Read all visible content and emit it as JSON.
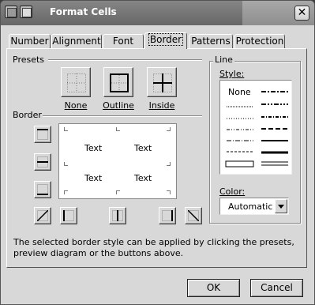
{
  "window": {
    "title": "Format Cells",
    "close_glyph": "✕"
  },
  "tabs": [
    {
      "label": "Number"
    },
    {
      "label": "Alignment"
    },
    {
      "label": "Font"
    },
    {
      "label": "Border",
      "active": true
    },
    {
      "label": "Patterns"
    },
    {
      "label": "Protection"
    }
  ],
  "presets": {
    "group_label": "Presets",
    "items": [
      {
        "label": "None",
        "icon": "border-none-icon"
      },
      {
        "label": "Outline",
        "icon": "border-outline-icon"
      },
      {
        "label": "Inside",
        "icon": "border-inside-icon"
      }
    ]
  },
  "border": {
    "group_label": "Border",
    "preview_text": [
      "Text",
      "Text",
      "Text",
      "Text"
    ],
    "buttons": [
      "border-top-icon",
      "border-middle-horizontal-icon",
      "border-bottom-icon",
      "border-diagonal-up-icon",
      "border-left-icon",
      "border-middle-vertical-icon",
      "border-right-icon",
      "border-diagonal-down-icon"
    ]
  },
  "line": {
    "group_label": "Line",
    "style_label": "Style:",
    "style_none": "None",
    "color_label": "Color:",
    "color_value": "Automatic"
  },
  "help_text": "The selected border style can be applied by clicking the presets, preview diagram or the buttons above.",
  "buttons": {
    "ok": "OK",
    "cancel": "Cancel"
  }
}
